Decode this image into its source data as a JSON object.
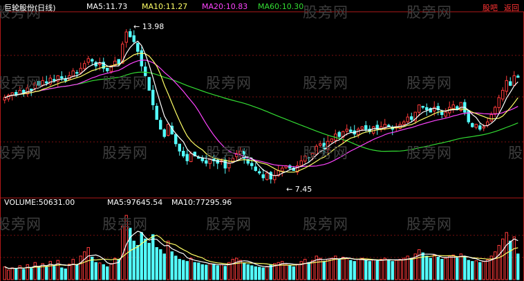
{
  "header": {
    "title": "巨轮股份(日线)",
    "ma5": "MA5:11.73",
    "ma10": "MA10:11.27",
    "ma20": "MA20:10.83",
    "ma60": "MA60:10.30",
    "link_guba": "股吧",
    "link_back": "返回"
  },
  "volume_header": {
    "volume": "VOLUME:50631.00",
    "ma5": "MA5:97645.54",
    "ma10": "MA10:77295.96"
  },
  "watermark": "股旁网",
  "colors": {
    "up": "#ff3b3b",
    "down": "#54ffff",
    "ma5": "#ffffff",
    "ma10": "#ffff66",
    "ma20": "#ff44ff",
    "ma60": "#33dd33",
    "grid": "#b01818"
  },
  "chart_data": {
    "type": "candlestick",
    "title": "巨轮股份(日线)",
    "price_range": [
      7.0,
      14.4
    ],
    "annotations": [
      {
        "label": "13.98",
        "value": 13.98,
        "kind": "high",
        "bar": 33
      },
      {
        "label": "7.45",
        "value": 7.45,
        "kind": "low",
        "bar": 70
      }
    ],
    "series_names": [
      "MA5",
      "MA10",
      "MA20",
      "MA60",
      "VOLUME"
    ],
    "current": {
      "MA5": 11.73,
      "MA10": 11.27,
      "MA20": 10.83,
      "MA60": 10.3,
      "VOLUME": 50631.0,
      "VOL_MA5": 97645.54,
      "VOL_MA10": 77295.96
    },
    "close": [
      10.9,
      11.0,
      11.1,
      11.0,
      11.2,
      11.1,
      11.3,
      11.2,
      11.5,
      11.4,
      11.6,
      11.5,
      11.7,
      11.6,
      11.8,
      11.7,
      11.6,
      11.8,
      12.0,
      11.9,
      12.1,
      12.3,
      12.5,
      12.4,
      12.2,
      12.3,
      12.1,
      12.0,
      12.2,
      12.4,
      12.3,
      13.1,
      13.6,
      13.4,
      13.2,
      12.8,
      12.2,
      11.8,
      11.2,
      10.6,
      10.0,
      9.6,
      9.3,
      9.8,
      9.4,
      9.0,
      8.7,
      8.5,
      8.3,
      8.6,
      8.5,
      8.4,
      8.3,
      8.2,
      8.4,
      8.3,
      8.2,
      8.3,
      8.0,
      8.2,
      8.4,
      8.6,
      8.7,
      8.4,
      8.2,
      8.1,
      7.9,
      7.8,
      7.6,
      7.8,
      7.55,
      7.7,
      7.9,
      8.0,
      8.1,
      8.0,
      7.9,
      8.1,
      8.3,
      8.5,
      8.4,
      8.6,
      8.9,
      9.0,
      8.8,
      9.1,
      9.2,
      9.4,
      9.3,
      9.5,
      9.6,
      9.5,
      9.4,
      9.6,
      9.7,
      9.6,
      9.5,
      9.7,
      9.6,
      9.7,
      9.8,
      9.7,
      9.6,
      9.7,
      9.8,
      9.9,
      10.1,
      10.0,
      10.3,
      10.6,
      10.5,
      10.4,
      10.3,
      10.5,
      10.4,
      10.2,
      10.3,
      10.5,
      10.6,
      10.4,
      10.7,
      10.3,
      9.9,
      9.7,
      9.8,
      9.6,
      9.7,
      9.9,
      10.2,
      10.5,
      10.9,
      11.2,
      11.6,
      11.4,
      11.8,
      11.73
    ],
    "volume": [
      60,
      45,
      55,
      50,
      65,
      48,
      70,
      52,
      80,
      60,
      75,
      58,
      85,
      62,
      90,
      55,
      50,
      72,
      95,
      68,
      110,
      130,
      150,
      105,
      80,
      78,
      70,
      60,
      75,
      100,
      95,
      250,
      300,
      240,
      180,
      160,
      220,
      190,
      170,
      210,
      150,
      140,
      120,
      180,
      130,
      110,
      95,
      90,
      85,
      100,
      80,
      78,
      70,
      68,
      75,
      72,
      65,
      70,
      62,
      80,
      95,
      100,
      90,
      75,
      70,
      65,
      60,
      58,
      55,
      62,
      70,
      75,
      80,
      85,
      70,
      65,
      60,
      72,
      85,
      95,
      80,
      90,
      110,
      100,
      85,
      95,
      100,
      110,
      95,
      105,
      98,
      90,
      85,
      95,
      100,
      90,
      85,
      92,
      88,
      95,
      100,
      92,
      85,
      90,
      95,
      100,
      110,
      100,
      120,
      140,
      125,
      110,
      100,
      115,
      105,
      95,
      100,
      110,
      115,
      100,
      120,
      105,
      90,
      85,
      88,
      80,
      85,
      92,
      110,
      130,
      160,
      190,
      220,
      180,
      200,
      120
    ]
  }
}
